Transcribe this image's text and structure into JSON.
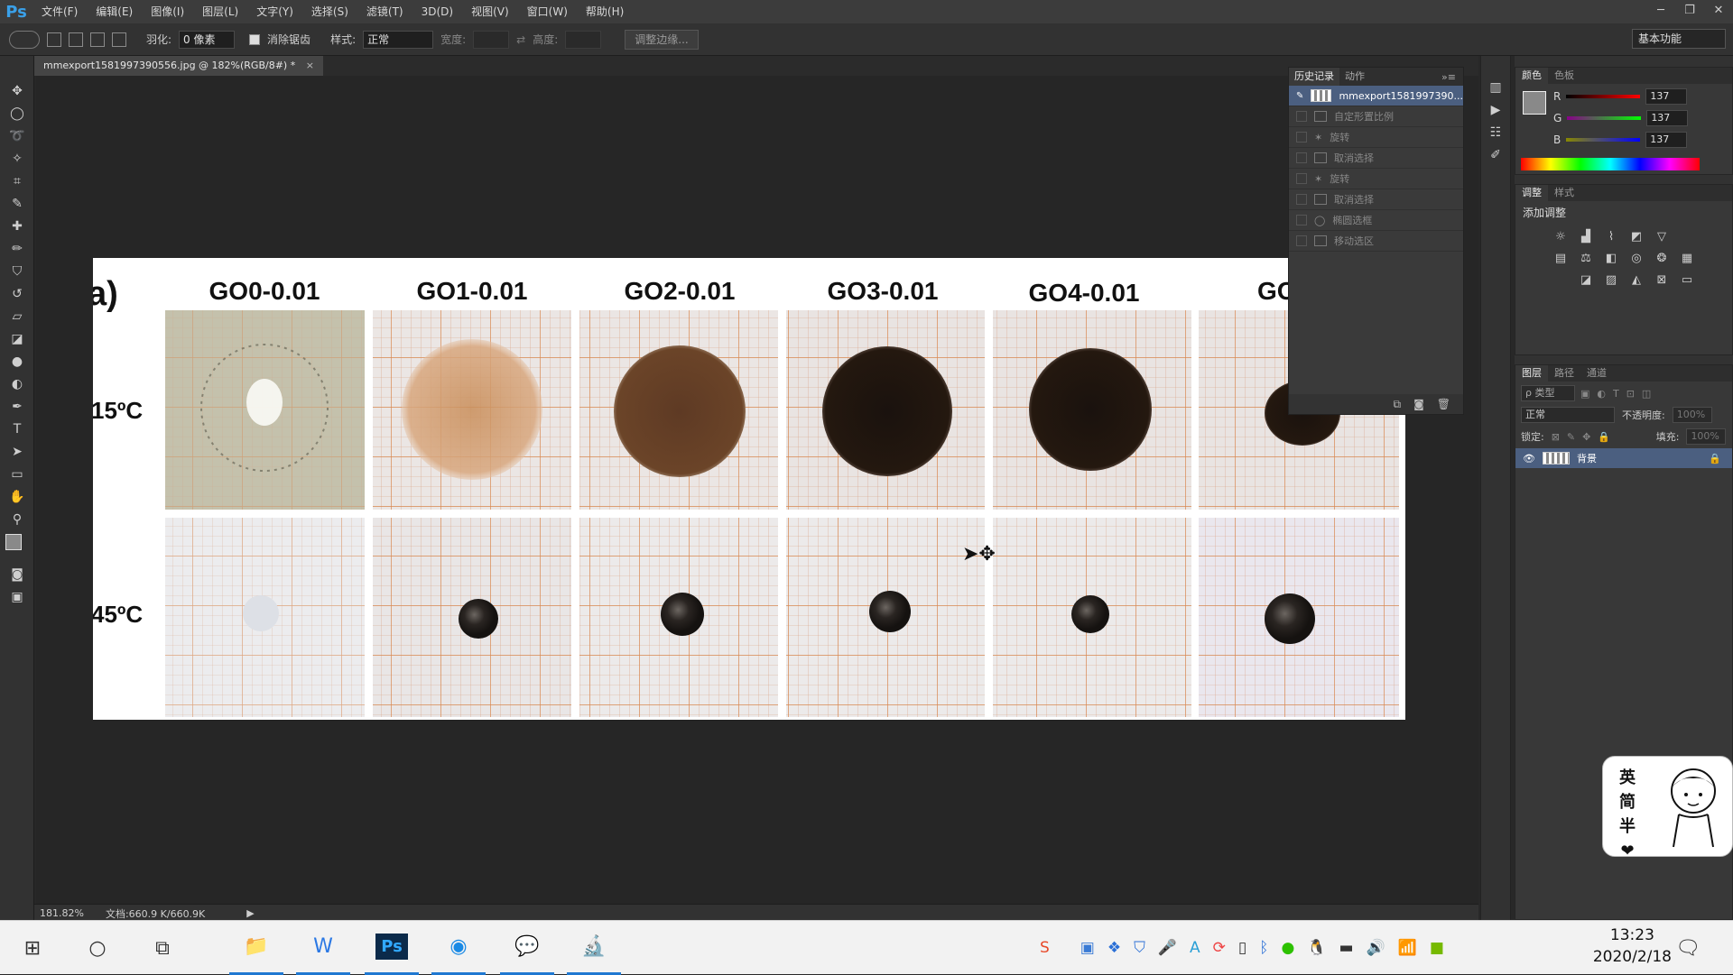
{
  "app": {
    "logo": "Ps",
    "menus": [
      "文件(F)",
      "编辑(E)",
      "图像(I)",
      "图层(L)",
      "文字(Y)",
      "选择(S)",
      "滤镜(T)",
      "3D(D)",
      "视图(V)",
      "窗口(W)",
      "帮助(H)"
    ],
    "window_controls": [
      "─",
      "❐",
      "✕"
    ]
  },
  "options": {
    "feather_label": "羽化:",
    "feather_value": "0 像素",
    "antialias_label": "消除锯齿",
    "style_label": "样式:",
    "style_value": "正常",
    "width_label": "宽度:",
    "height_label": "高度:",
    "refine_edge": "调整边缘...",
    "workspace": "基本功能"
  },
  "document": {
    "tab_title": "mmexport1581997390556.jpg @ 182%(RGB/8#) *",
    "zoom": "181.82%",
    "doc_size": "文档:660.9 K/660.9K"
  },
  "image": {
    "corner_label": "a)",
    "columns": [
      "GO0-0.01",
      "GO1-0.01",
      "GO2-0.01",
      "GO3-0.01",
      "GO4-0.01",
      "GO"
    ],
    "rows": [
      "15ºC",
      "45ºC"
    ]
  },
  "history": {
    "tabs": [
      "历史记录",
      "动作"
    ],
    "snapshot": "mmexport1581997390...",
    "items": [
      "自定形置比例",
      "旋转",
      "取消选择",
      "旋转",
      "取消选择",
      "椭圆选框",
      "移动选区"
    ]
  },
  "color_panel": {
    "tabs": [
      "颜色",
      "色板"
    ],
    "channels": [
      {
        "label": "R",
        "value": "137"
      },
      {
        "label": "G",
        "value": "137"
      },
      {
        "label": "B",
        "value": "137"
      }
    ],
    "fg_color": "#898989"
  },
  "adjustments": {
    "tabs": [
      "调整",
      "样式"
    ],
    "title": "添加调整"
  },
  "layers": {
    "tabs": [
      "图层",
      "路径",
      "通道"
    ],
    "kind_label": "ρ 类型",
    "blend_mode": "正常",
    "opacity_label": "不透明度:",
    "opacity_value": "100%",
    "lock_label": "锁定:",
    "fill_label": "填充:",
    "fill_value": "100%",
    "layer_name": "背景"
  },
  "taskbar": {
    "time": "13:23",
    "date": "2020/2/18"
  },
  "sticker": {
    "chars": [
      "英",
      "简",
      "半",
      "❤"
    ]
  }
}
